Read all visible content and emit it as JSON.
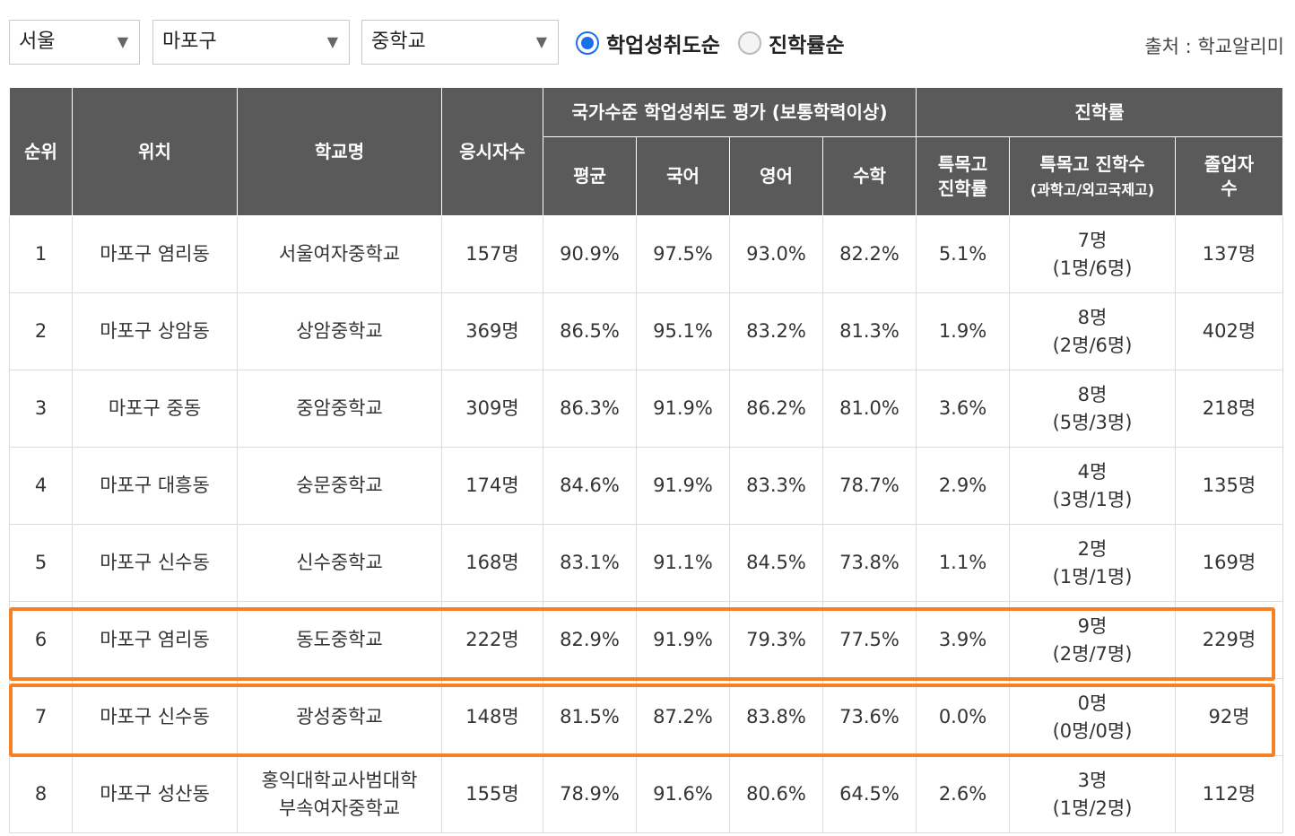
{
  "filters": {
    "region": "서울",
    "district": "마포구",
    "school_level": "중학교",
    "sort_options": [
      {
        "label": "학업성취도순",
        "selected": true
      },
      {
        "label": "진학률순",
        "selected": false
      }
    ],
    "source": "출처 : 학교알리미"
  },
  "colors": {
    "header_bg": "#5a5a5a",
    "highlight": "#f58025",
    "radio_accent": "#1a6fe8"
  },
  "table": {
    "headers": {
      "rank": "순위",
      "location": "위치",
      "school": "학교명",
      "examinees": "응시자수",
      "achievement_group": "국가수준 학업성취도 평가 (보통학력이상)",
      "avg": "평균",
      "korean": "국어",
      "english": "영어",
      "math": "수학",
      "advancement_group": "진학률",
      "special_rate_1": "특목고",
      "special_rate_2": "진학률",
      "special_count_1": "특목고 진학수",
      "special_count_2": "(과학고/외고국제고)",
      "graduates_1": "졸업자",
      "graduates_2": "수"
    },
    "rows": [
      {
        "rank": "1",
        "location": "마포구 염리동",
        "school_1": "서울여자중학교",
        "school_2": "",
        "examinees": "157명",
        "avg": "90.9%",
        "korean": "97.5%",
        "english": "93.0%",
        "math": "82.2%",
        "special_rate": "5.1%",
        "special_count": "7명",
        "special_breakdown": "(1명/6명)",
        "graduates": "137명"
      },
      {
        "rank": "2",
        "location": "마포구 상암동",
        "school_1": "상암중학교",
        "school_2": "",
        "examinees": "369명",
        "avg": "86.5%",
        "korean": "95.1%",
        "english": "83.2%",
        "math": "81.3%",
        "special_rate": "1.9%",
        "special_count": "8명",
        "special_breakdown": "(2명/6명)",
        "graduates": "402명"
      },
      {
        "rank": "3",
        "location": "마포구 중동",
        "school_1": "중암중학교",
        "school_2": "",
        "examinees": "309명",
        "avg": "86.3%",
        "korean": "91.9%",
        "english": "86.2%",
        "math": "81.0%",
        "special_rate": "3.6%",
        "special_count": "8명",
        "special_breakdown": "(5명/3명)",
        "graduates": "218명"
      },
      {
        "rank": "4",
        "location": "마포구 대흥동",
        "school_1": "숭문중학교",
        "school_2": "",
        "examinees": "174명",
        "avg": "84.6%",
        "korean": "91.9%",
        "english": "83.3%",
        "math": "78.7%",
        "special_rate": "2.9%",
        "special_count": "4명",
        "special_breakdown": "(3명/1명)",
        "graduates": "135명"
      },
      {
        "rank": "5",
        "location": "마포구 신수동",
        "school_1": "신수중학교",
        "school_2": "",
        "examinees": "168명",
        "avg": "83.1%",
        "korean": "91.1%",
        "english": "84.5%",
        "math": "73.8%",
        "special_rate": "1.1%",
        "special_count": "2명",
        "special_breakdown": "(1명/1명)",
        "graduates": "169명"
      },
      {
        "rank": "6",
        "location": "마포구 염리동",
        "school_1": "동도중학교",
        "school_2": "",
        "examinees": "222명",
        "avg": "82.9%",
        "korean": "91.9%",
        "english": "79.3%",
        "math": "77.5%",
        "special_rate": "3.9%",
        "special_count": "9명",
        "special_breakdown": "(2명/7명)",
        "graduates": "229명"
      },
      {
        "rank": "7",
        "location": "마포구 신수동",
        "school_1": "광성중학교",
        "school_2": "",
        "examinees": "148명",
        "avg": "81.5%",
        "korean": "87.2%",
        "english": "83.8%",
        "math": "73.6%",
        "special_rate": "0.0%",
        "special_count": "0명",
        "special_breakdown": "(0명/0명)",
        "graduates": "92명"
      },
      {
        "rank": "8",
        "location": "마포구 성산동",
        "school_1": "홍익대학교사범대학",
        "school_2": "부속여자중학교",
        "examinees": "155명",
        "avg": "78.9%",
        "korean": "91.6%",
        "english": "80.6%",
        "math": "64.5%",
        "special_rate": "2.6%",
        "special_count": "3명",
        "special_breakdown": "(1명/2명)",
        "graduates": "112명"
      }
    ]
  }
}
